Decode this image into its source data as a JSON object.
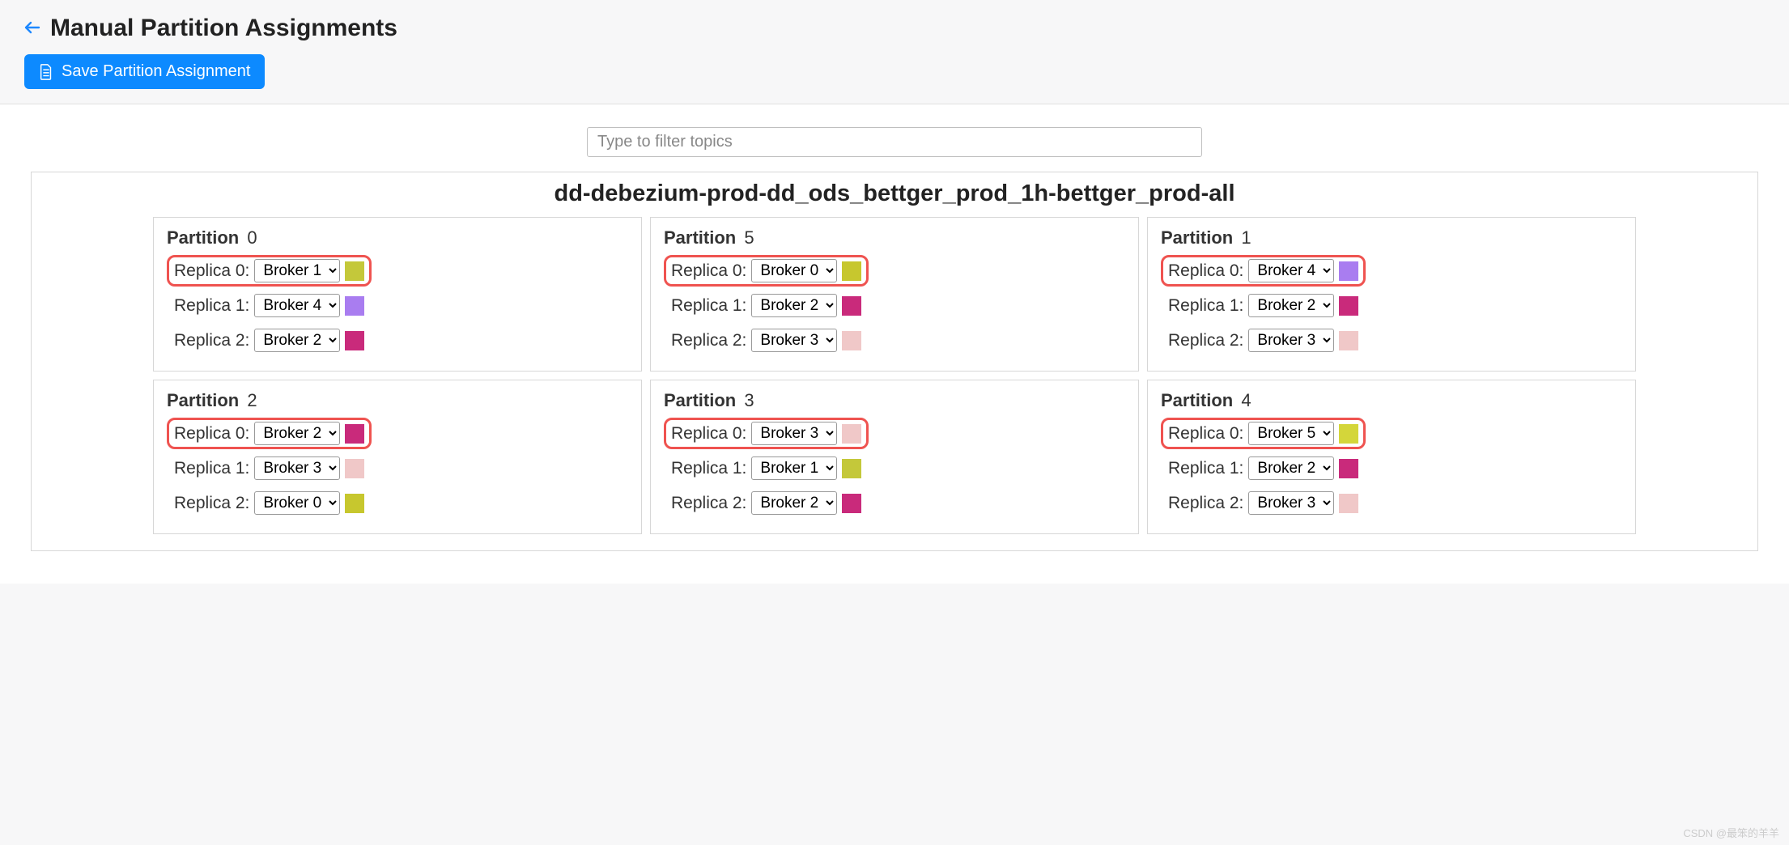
{
  "header": {
    "title": "Manual Partition Assignments",
    "save_button_label": "Save Partition Assignment"
  },
  "filter": {
    "placeholder": "Type to filter topics"
  },
  "broker_options": [
    "Broker 0",
    "Broker 1",
    "Broker 2",
    "Broker 3",
    "Broker 4",
    "Broker 5"
  ],
  "broker_colors": {
    "Broker 0": "#c7c72e",
    "Broker 1": "#c4c83a",
    "Broker 2": "#c92a7b",
    "Broker 3": "#f0c8c8",
    "Broker 4": "#a97df0",
    "Broker 5": "#d4d63a"
  },
  "topic": {
    "name": "dd-debezium-prod-dd_ods_bettger_prod_1h-bettger_prod-all",
    "partition_label": "Partition",
    "replica_label": "Replica",
    "partitions": [
      {
        "id": 0,
        "replicas": [
          {
            "index": 0,
            "broker": "Broker 1",
            "highlighted": true
          },
          {
            "index": 1,
            "broker": "Broker 4",
            "highlighted": false
          },
          {
            "index": 2,
            "broker": "Broker 2",
            "highlighted": false
          }
        ]
      },
      {
        "id": 5,
        "replicas": [
          {
            "index": 0,
            "broker": "Broker 0",
            "highlighted": true
          },
          {
            "index": 1,
            "broker": "Broker 2",
            "highlighted": false
          },
          {
            "index": 2,
            "broker": "Broker 3",
            "highlighted": false
          }
        ]
      },
      {
        "id": 1,
        "replicas": [
          {
            "index": 0,
            "broker": "Broker 4",
            "highlighted": true
          },
          {
            "index": 1,
            "broker": "Broker 2",
            "highlighted": false
          },
          {
            "index": 2,
            "broker": "Broker 3",
            "highlighted": false
          }
        ]
      },
      {
        "id": 2,
        "replicas": [
          {
            "index": 0,
            "broker": "Broker 2",
            "highlighted": true
          },
          {
            "index": 1,
            "broker": "Broker 3",
            "highlighted": false
          },
          {
            "index": 2,
            "broker": "Broker 0",
            "highlighted": false
          }
        ]
      },
      {
        "id": 3,
        "replicas": [
          {
            "index": 0,
            "broker": "Broker 3",
            "highlighted": true
          },
          {
            "index": 1,
            "broker": "Broker 1",
            "highlighted": false
          },
          {
            "index": 2,
            "broker": "Broker 2",
            "highlighted": false
          }
        ]
      },
      {
        "id": 4,
        "replicas": [
          {
            "index": 0,
            "broker": "Broker 5",
            "highlighted": true
          },
          {
            "index": 1,
            "broker": "Broker 2",
            "highlighted": false
          },
          {
            "index": 2,
            "broker": "Broker 3",
            "highlighted": false
          }
        ]
      }
    ]
  },
  "watermark": "CSDN @最笨的羊羊"
}
